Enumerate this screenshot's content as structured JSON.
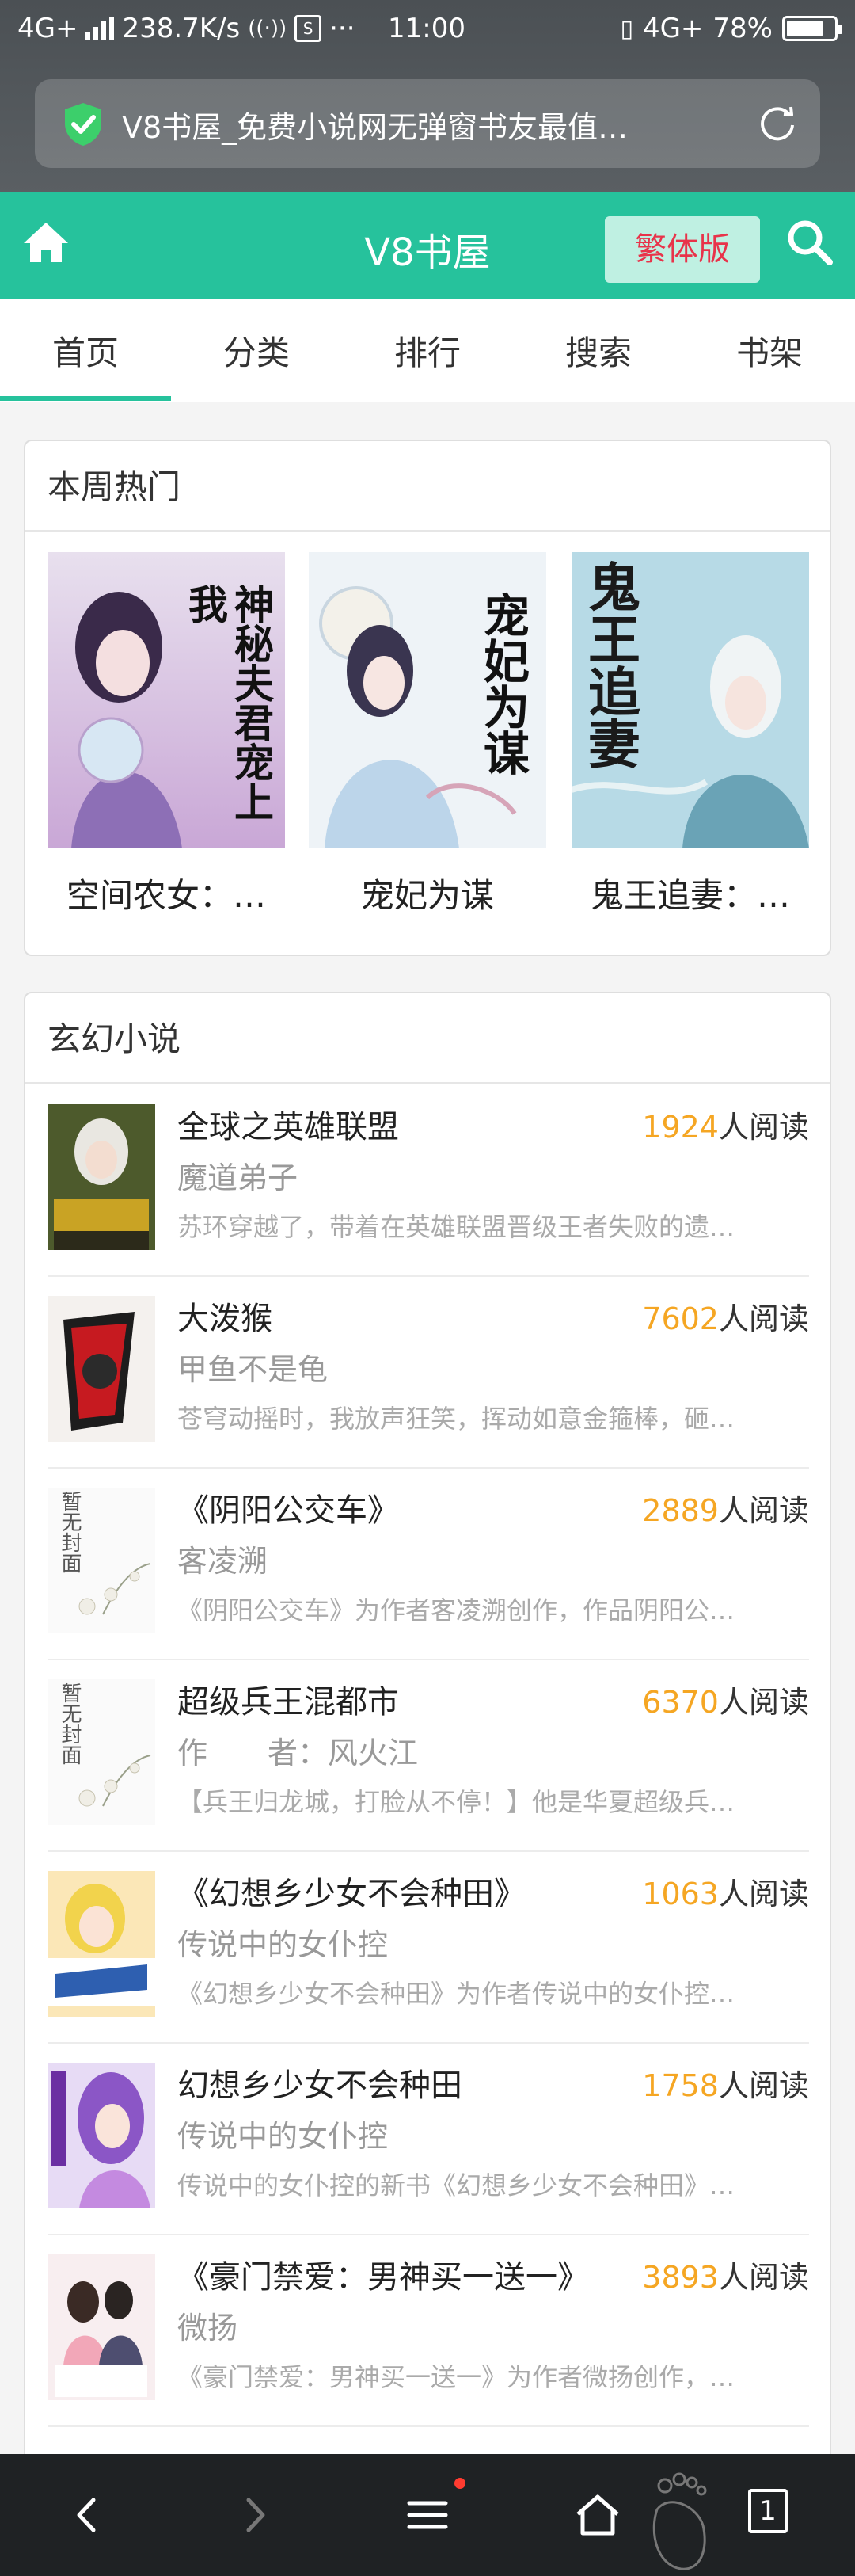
{
  "status_bar": {
    "network": "4G+",
    "speed": "238.7K/s",
    "extra": "···",
    "time": "11:00",
    "right_network": "4G+",
    "battery": "78%",
    "battery_level": 0.78
  },
  "url_bar": {
    "text": "V8书屋_免费小说网无弹窗书友最值…"
  },
  "app_header": {
    "title": "V8书屋",
    "traditional_button": "繁体版"
  },
  "tabs": [
    {
      "label": "首页",
      "active": true
    },
    {
      "label": "分类"
    },
    {
      "label": "排行"
    },
    {
      "label": "搜索"
    },
    {
      "label": "书架"
    }
  ],
  "hot_section": {
    "title": "本周热门",
    "items": [
      {
        "name": "空间农女：…",
        "cover_text": "神秘夫君宠上我"
      },
      {
        "name": "宠妃为谋",
        "cover_text": "宠妃为谋"
      },
      {
        "name": "鬼王追妻：…",
        "cover_text": "鬼王追妻"
      }
    ]
  },
  "fantasy_section": {
    "title": "玄幻小说",
    "read_suffix": "人阅读",
    "items": [
      {
        "title": "全球之英雄联盟",
        "reads": "1924",
        "author": "魔道弟子",
        "desc": "苏环穿越了，带着在英雄联盟晋级王者失败的遗…"
      },
      {
        "title": "大泼猴",
        "reads": "7602",
        "author": "甲鱼不是龟",
        "desc": "苍穹动摇时，我放声狂笑，挥动如意金箍棒，砸…"
      },
      {
        "title": "《阴阳公交车》",
        "reads": "2889",
        "author": "客凌溯",
        "desc": "《阴阳公交车》为作者客凌溯创作，作品阴阳公…"
      },
      {
        "title": "超级兵王混都市",
        "reads": "6370",
        "author": "作　　者：风火江",
        "desc": "【兵王归龙城，打脸从不停！】他是华夏超级兵…"
      },
      {
        "title": "《幻想乡少女不会种田》",
        "reads": "1063",
        "author": "传说中的女仆控",
        "desc": "《幻想乡少女不会种田》为作者传说中的女仆控…"
      },
      {
        "title": "幻想乡少女不会种田",
        "reads": "1758",
        "author": "传说中的女仆控",
        "desc": "传说中的女仆控的新书《幻想乡少女不会种田》…"
      },
      {
        "title": "《豪门禁爱：男神买一送一》",
        "reads": "3893",
        "author": "微扬",
        "desc": "《豪门禁爱：男神买一送一》为作者微扬创作，…"
      }
    ]
  },
  "placeholder_cover_text": "暂无封面",
  "bottom_bar": {
    "tab_count": "1"
  },
  "colors": {
    "brand": "#26c29c",
    "read_count": "#f5a623",
    "traditional_text": "#e8334a"
  }
}
